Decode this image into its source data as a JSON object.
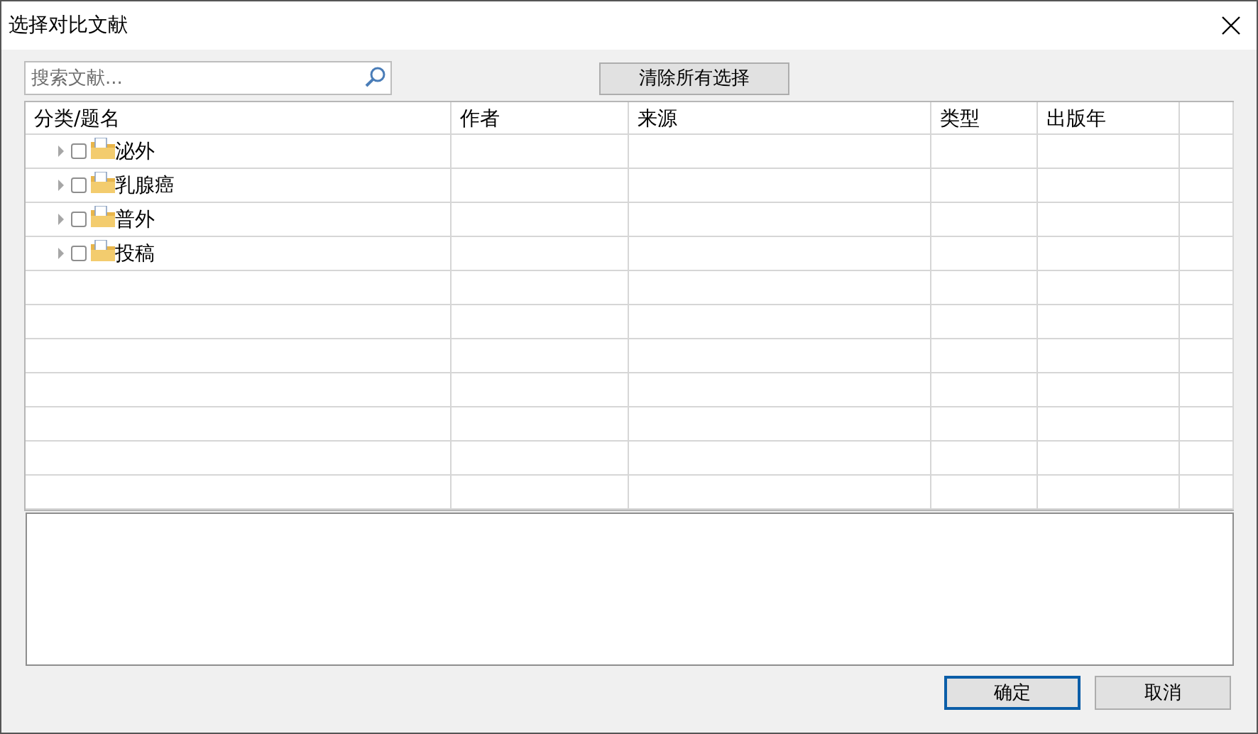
{
  "window": {
    "title": "选择对比文献"
  },
  "search": {
    "placeholder": "搜索文献..."
  },
  "clear_button": "清除所有选择",
  "table": {
    "columns": [
      "分类/题名",
      "作者",
      "来源",
      "类型",
      "出版年"
    ],
    "rows": [
      {
        "title": "泌外",
        "checked": false,
        "expanded": false
      },
      {
        "title": "乳腺癌",
        "checked": false,
        "expanded": false
      },
      {
        "title": "普外",
        "checked": false,
        "expanded": false
      },
      {
        "title": "投稿",
        "checked": false,
        "expanded": false
      }
    ]
  },
  "buttons": [
    {
      "label": "确定",
      "default": true
    },
    {
      "label": "取消",
      "default": false
    }
  ]
}
